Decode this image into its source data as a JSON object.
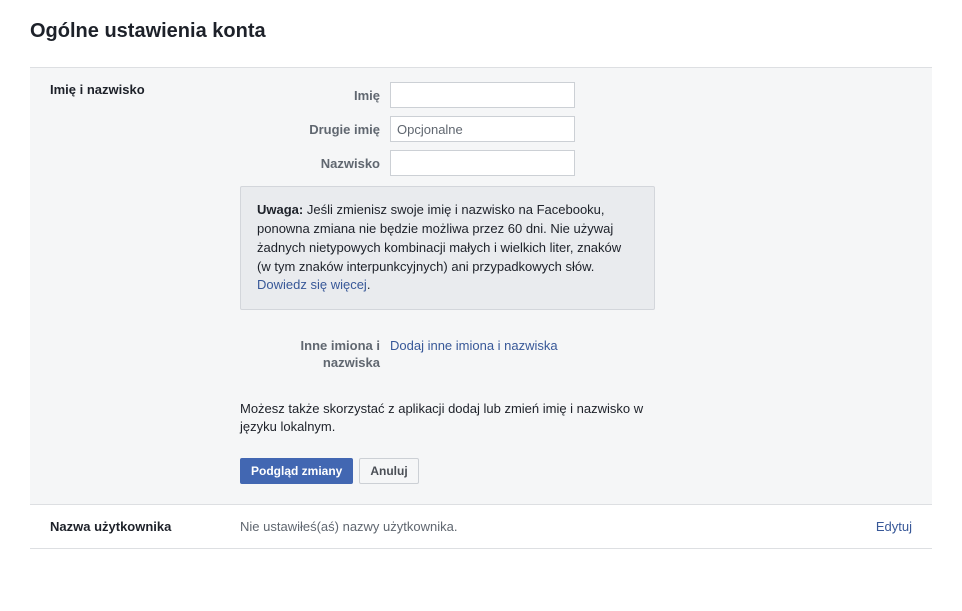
{
  "page": {
    "title": "Ogólne ustawienia konta"
  },
  "nameSection": {
    "title": "Imię i nazwisko",
    "fields": {
      "first": {
        "label": "Imię",
        "value": "",
        "placeholder": ""
      },
      "middle": {
        "label": "Drugie imię",
        "value": "",
        "placeholder": "Opcjonalne"
      },
      "last": {
        "label": "Nazwisko",
        "value": "",
        "placeholder": ""
      }
    },
    "notice": {
      "strong": "Uwaga:",
      "text": " Jeśli zmienisz swoje imię i nazwisko na Facebooku, ponowna zmiana nie będzie możliwa przez 60 dni. Nie używaj żadnych nietypowych kombinacji małych i wielkich liter, znaków (w tym znaków interpunkcyjnych) ani przypadkowych słów. ",
      "link": "Dowiedz się więcej",
      "after": "."
    },
    "otherNames": {
      "label": "Inne imiona i nazwiska",
      "link": "Dodaj inne imiona i nazwiska"
    },
    "helper": "Możesz także skorzystać z aplikacji dodaj lub zmień imię i nazwisko w języku lokalnym.",
    "buttons": {
      "preview": "Podgląd zmiany",
      "cancel": "Anuluj"
    }
  },
  "usernameSection": {
    "title": "Nazwa użytkownika",
    "value": "Nie ustawiłeś(aś) nazwy użytkownika.",
    "editLink": "Edytuj"
  }
}
